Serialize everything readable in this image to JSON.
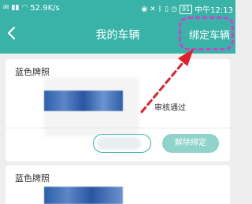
{
  "status_bar": {
    "net_speed": "52.9K/s",
    "battery": "91",
    "time": "中午12:13"
  },
  "header": {
    "title": "我的车辆",
    "bind_label": "绑定车辆"
  },
  "vehicles": [
    {
      "plate_type": "蓝色牌照",
      "status": "审核通过",
      "unbind_label": "解除绑定"
    },
    {
      "plate_type": "蓝色牌照"
    }
  ],
  "colors": {
    "header_bg": "#39b3a7",
    "highlight": "#cc44cc",
    "arrow": "#e0202a",
    "unbind_bg": "#8fd3cb"
  }
}
